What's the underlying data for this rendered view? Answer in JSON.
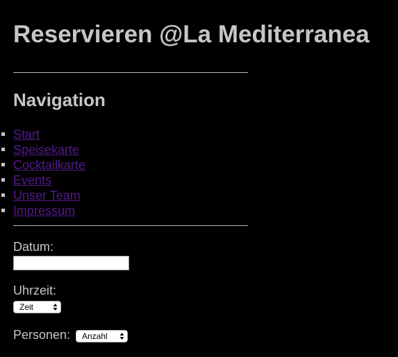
{
  "page": {
    "title": "Reservieren @La Mediterranea"
  },
  "nav": {
    "heading": "Navigation",
    "items": [
      {
        "label": "Start"
      },
      {
        "label": "Speisekarte"
      },
      {
        "label": "Cocktailkarte"
      },
      {
        "label": "Events"
      },
      {
        "label": "Unser Team"
      },
      {
        "label": "Impressum"
      }
    ]
  },
  "form": {
    "date_label": "Datum:",
    "date_value": "",
    "time_label": "Uhrzeit:",
    "time_selected": "Zeit",
    "persons_label": "Personen:",
    "persons_selected": "Anzahl"
  },
  "colors": {
    "background": "#000000",
    "text": "#c6c6c6",
    "link": "#551a8b"
  }
}
